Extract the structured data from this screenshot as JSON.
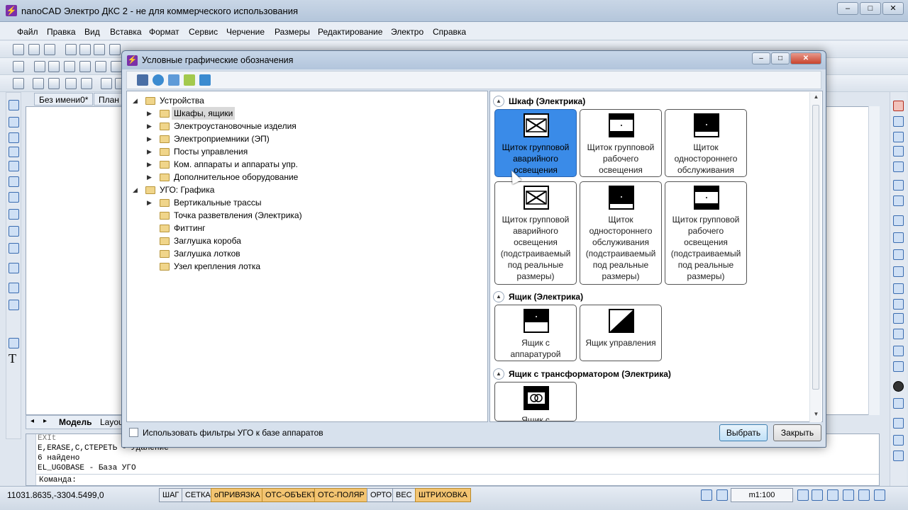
{
  "app": {
    "title": "nanoCAD Электро ДКС 2 - не для коммерческого использования",
    "window_buttons": [
      "–",
      "□",
      "✕"
    ]
  },
  "menu": [
    "Файл",
    "Правка",
    "Вид",
    "Вставка",
    "Формат",
    "Сервис",
    "Черчение",
    "Размеры",
    "Редактирование",
    "Электро",
    "Справка"
  ],
  "document_tabs": [
    "Без имени0*",
    "План"
  ],
  "layout_tabs": [
    "Модель",
    "Layou"
  ],
  "command_lines": [
    "EXIt",
    "E,ERASE,C,СТЕРЕТЬ - Удаление",
    "6 найдено",
    "EL_UGOBASE - База УГО"
  ],
  "command_prompt": "Команда:",
  "status": {
    "coords": "11031.8635,-3304.5499,0",
    "buttons": [
      {
        "label": "ШАГ",
        "on": false
      },
      {
        "label": "СЕТКА",
        "on": false
      },
      {
        "label": "оПРИВЯЗКА",
        "on": true
      },
      {
        "label": "ОТС-ОБЪЕКТ",
        "on": true
      },
      {
        "label": "ОТС-ПОЛЯР",
        "on": true
      },
      {
        "label": "ОРТО",
        "on": false
      },
      {
        "label": "ВЕС",
        "on": false
      },
      {
        "label": "ШТРИХОВКА",
        "on": true
      }
    ],
    "scale": "m1:100"
  },
  "dialog": {
    "title": "Условные графические обозначения",
    "tree": [
      {
        "label": "Устройства",
        "level": 0,
        "expanded": true,
        "arrow": true
      },
      {
        "label": "Шкафы, ящики",
        "level": 1,
        "selected": true,
        "arrow": true
      },
      {
        "label": "Электроустановочные изделия",
        "level": 1,
        "arrow": true
      },
      {
        "label": "Электроприемники (ЭП)",
        "level": 1,
        "arrow": true
      },
      {
        "label": "Посты управления",
        "level": 1,
        "arrow": true
      },
      {
        "label": "Ком. аппараты и аппараты упр.",
        "level": 1,
        "arrow": true
      },
      {
        "label": "Дополнительное оборудование",
        "level": 1,
        "arrow": true
      },
      {
        "label": "УГО: Графика",
        "level": 0,
        "expanded": true,
        "arrow": true
      },
      {
        "label": "Вертикальные трассы",
        "level": 1,
        "arrow": true
      },
      {
        "label": "Точка разветвления (Электрика)",
        "level": 1,
        "arrow": false
      },
      {
        "label": "Фиттинг",
        "level": 1,
        "arrow": false
      },
      {
        "label": "Заглушка короба",
        "level": 1,
        "arrow": false
      },
      {
        "label": "Заглушка лотков",
        "level": 1,
        "arrow": false
      },
      {
        "label": "Узел крепления лотка",
        "level": 1,
        "arrow": false
      }
    ],
    "groups": [
      {
        "title": "Шкаф (Электрика)",
        "items": [
          {
            "label": "Щиток групповой аварийного освещения",
            "symbol": "cross-box",
            "selected": true
          },
          {
            "label": "Щиток групповой рабочего освещения",
            "symbol": "top-band"
          },
          {
            "label": "Щиток одностороннего обслуживания",
            "symbol": "filled-dot"
          },
          {
            "label": "Щиток групповой аварийного освещения (подстраиваемый под реальные размеры)",
            "symbol": "cross-box"
          },
          {
            "label": "Щиток одностороннего обслуживания (подстраиваемый под реальные размеры)",
            "symbol": "filled-dot"
          },
          {
            "label": "Щиток групповой рабочего освещения (подстраиваемый под реальные размеры)",
            "symbol": "top-band"
          }
        ]
      },
      {
        "title": "Ящик (Электрика)",
        "items": [
          {
            "label": "Ящик с аппаратурой",
            "symbol": "top-filled"
          },
          {
            "label": "Ящик управления",
            "symbol": "diagonal"
          }
        ]
      },
      {
        "title": "Ящик с трансформатором (Электрика)",
        "items": [
          {
            "label": "Ящик с",
            "symbol": "transformer"
          }
        ]
      }
    ],
    "filter_label": "Использовать фильтры УГО к базе аппаратов",
    "filter_checked": false,
    "select_button": "Выбрать",
    "close_button": "Закрыть"
  }
}
